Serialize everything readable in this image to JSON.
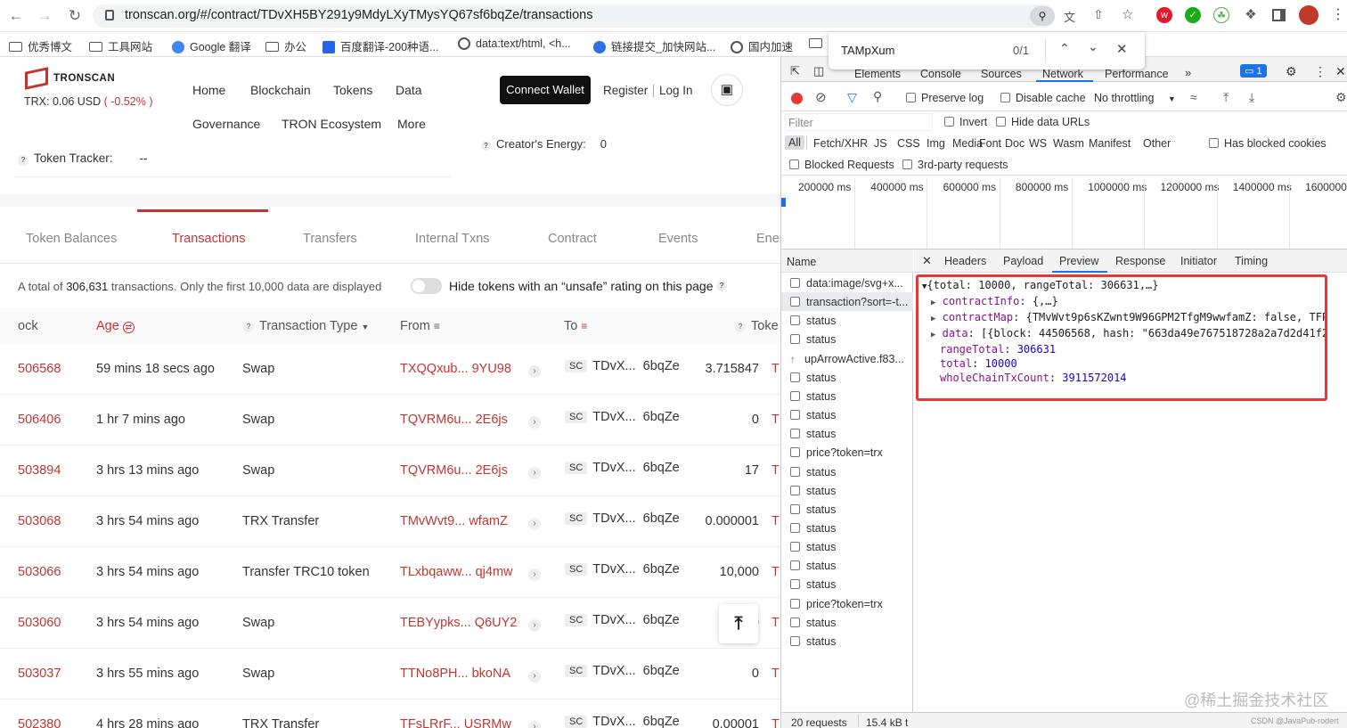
{
  "browser": {
    "url": "tronscan.org/#/contract/TDvXH5BY291y9MdyLXyTMysYQ67sf6bqZe/transactions",
    "bookmarks": [
      "优秀博文",
      "工具网站",
      "Google 翻译",
      "办公",
      "百度翻译-200种语...",
      "data:text/html, <h...",
      "链接提交_加快网站...",
      "国内加速"
    ],
    "find": {
      "query": "TAMpXum",
      "count": "0/1"
    }
  },
  "site": {
    "brand": "TRONSCAN",
    "price_label": "TRX: 0.06 USD",
    "price_change": "( -0.52% )",
    "nav": [
      "Home",
      "Blockchain",
      "Tokens",
      "Data",
      "Governance",
      "TRON Ecosystem",
      "More"
    ],
    "connect_wallet": "Connect Wallet",
    "register": "Register",
    "login": "Log In",
    "token_tracker_label": "Token Tracker:",
    "token_tracker_value": "--",
    "creator_energy_label": "Creator's Energy:",
    "creator_energy_value": "0",
    "tabs": [
      "Token Balances",
      "Transactions",
      "Transfers",
      "Internal Txns",
      "Contract",
      "Events",
      "Ener"
    ],
    "summary": {
      "prefix": "A total of ",
      "count": "306,631",
      "suffix": " transactions. Only the first 10,000 data are displayed"
    },
    "hide_unsafe": "Hide tokens with an “unsafe” rating on this page",
    "columns": [
      "ock",
      "Age",
      "Transaction Type",
      "From",
      "To",
      "Toke"
    ],
    "rows": [
      {
        "block": "506568",
        "age": "59 mins 18 secs ago",
        "type": "Swap",
        "from": "TXQQxub... 9YU98",
        "to_a": "TDvX...",
        "to_b": "6bqZe",
        "amount": "3.715847",
        "unit": "T"
      },
      {
        "block": "506406",
        "age": "1 hr 7 mins ago",
        "type": "Swap",
        "from": "TQVRM6u... 2E6js",
        "to_a": "TDvX...",
        "to_b": "6bqZe",
        "amount": "0",
        "unit": "T"
      },
      {
        "block": "503894",
        "age": "3 hrs 13 mins ago",
        "type": "Swap",
        "from": "TQVRM6u... 2E6js",
        "to_a": "TDvX...",
        "to_b": "6bqZe",
        "amount": "17",
        "unit": "T"
      },
      {
        "block": "503068",
        "age": "3 hrs 54 mins ago",
        "type": "TRX Transfer",
        "from": "TMvWvt9... wfamZ",
        "to_a": "TDvX...",
        "to_b": "6bqZe",
        "amount": "0.000001",
        "unit": "T"
      },
      {
        "block": "503066",
        "age": "3 hrs 54 mins ago",
        "type": "Transfer TRC10 token",
        "from": "TLxbqaww... qj4mw",
        "to_a": "TDvX...",
        "to_b": "6bqZe",
        "amount": "10,000",
        "unit": "TU"
      },
      {
        "block": "503060",
        "age": "3 hrs 54 mins ago",
        "type": "Swap",
        "from": "TEBYypks... Q6UY2",
        "to_a": "TDvX...",
        "to_b": "6bqZe",
        "amount": "0",
        "unit": "T"
      },
      {
        "block": "503037",
        "age": "3 hrs 55 mins ago",
        "type": "Swap",
        "from": "TTNo8PH... bkoNA",
        "to_a": "TDvX...",
        "to_b": "6bqZe",
        "amount": "0",
        "unit": "T"
      },
      {
        "block": "502380",
        "age": "4 hrs 28 mins ago",
        "type": "TRX Transfer",
        "from": "TFsLRrF... USRMw",
        "to_a": "TDvX...",
        "to_b": "6bqZe",
        "amount": "0.00001",
        "unit": "T"
      }
    ],
    "sc": "SC"
  },
  "devtools": {
    "tabs": [
      "Elements",
      "Console",
      "Sources",
      "Network",
      "Performance"
    ],
    "issues": "1",
    "preserve_log": "Preserve log",
    "disable_cache": "Disable cache",
    "throttling": "No throttling",
    "filter_placeholder": "Filter",
    "invert": "Invert",
    "hide_data_urls": "Hide data URLs",
    "types": [
      "All",
      "Fetch/XHR",
      "JS",
      "CSS",
      "Img",
      "Media",
      "Font",
      "Doc",
      "WS",
      "Wasm",
      "Manifest",
      "Other"
    ],
    "blocked_cookies": "Has blocked cookies",
    "blocked_requests": "Blocked Requests",
    "third_party": "3rd-party requests",
    "timeline": [
      "200000 ms",
      "400000 ms",
      "600000 ms",
      "800000 ms",
      "1000000 ms",
      "1200000 ms",
      "1400000 ms",
      "1600000 m"
    ],
    "name_header": "Name",
    "requests": [
      "data:image/svg+x...",
      "transaction?sort=-t...",
      "status",
      "status",
      "upArrowActive.f83...",
      "status",
      "status",
      "status",
      "status",
      "price?token=trx",
      "status",
      "status",
      "status",
      "status",
      "status",
      "status",
      "status",
      "price?token=trx",
      "status",
      "status"
    ],
    "detail_tabs": [
      "Headers",
      "Payload",
      "Preview",
      "Response",
      "Initiator",
      "Timing"
    ],
    "preview": {
      "line1": "{total: 10000, rangeTotal: 306631,…}",
      "contractInfo_key": "contractInfo",
      "contractInfo_val": "{,…}",
      "contractMap_key": "contractMap",
      "contractMap_val": "{TMvWvt9p6sKZwnt9W96GPM2TfgM9wwfamZ: false, TFPJjz",
      "data_key": "data",
      "data_val": "[{block: 44506568, hash: \"663da49e767518728a2a7d2d41f2f17",
      "rangeTotal_key": "rangeTotal",
      "rangeTotal_val": "306631",
      "total_key": "total",
      "total_val": "10000",
      "whole_key": "wholeChainTxCount",
      "whole_val": "3911572014"
    },
    "status_requests": "20 requests",
    "status_size": "15.4 kB t"
  },
  "watermark": "@稀土掘金技术社区",
  "watermark_small": "CSDN @JavaPub-rodert"
}
